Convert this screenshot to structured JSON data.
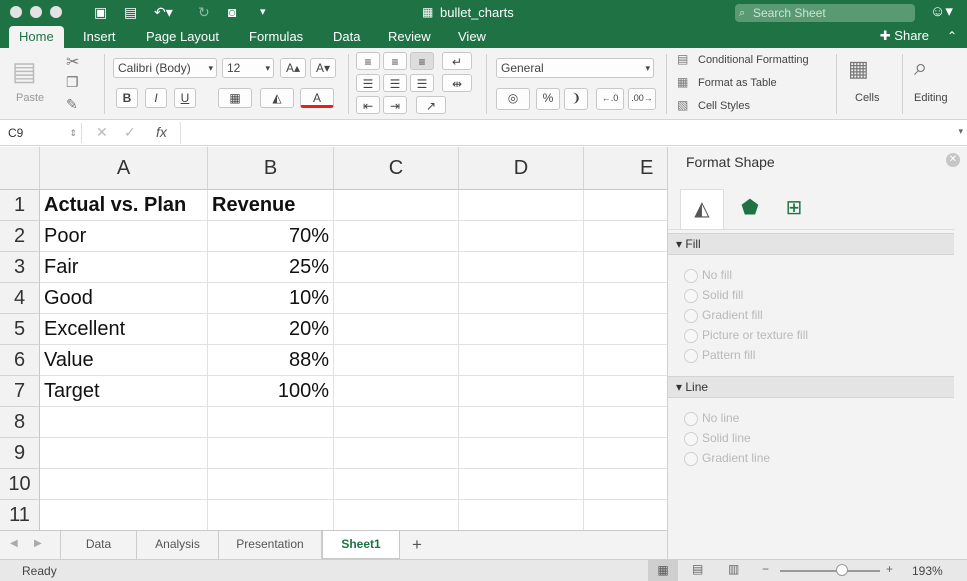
{
  "window": {
    "title": "bullet_charts",
    "search_placeholder": "Search Sheet"
  },
  "ribbon_tabs": [
    "Home",
    "Insert",
    "Page Layout",
    "Formulas",
    "Data",
    "Review",
    "View"
  ],
  "share_label": "Share",
  "ribbon": {
    "paste_label": "Paste",
    "font_name": "Calibri (Body)",
    "font_size": "12",
    "bold": "B",
    "italic": "I",
    "underline": "U",
    "number_format": "General",
    "percent": "%",
    "conditional_formatting": "Conditional Formatting",
    "format_as_table": "Format as Table",
    "cell_styles": "Cell Styles",
    "cells_label": "Cells",
    "editing_label": "Editing"
  },
  "formula_bar": {
    "name_box": "C9",
    "fx": "fx",
    "value": ""
  },
  "grid": {
    "columns": [
      "A",
      "B",
      "C",
      "D",
      "E"
    ],
    "rows": [
      "1",
      "2",
      "3",
      "4",
      "5",
      "6",
      "7",
      "8",
      "9",
      "10",
      "11"
    ],
    "data": [
      [
        "Actual vs. Plan",
        "Revenue"
      ],
      [
        "Poor",
        "70%"
      ],
      [
        "Fair",
        "25%"
      ],
      [
        "Good",
        "10%"
      ],
      [
        "Excellent",
        "20%"
      ],
      [
        "Value",
        "88%"
      ],
      [
        "Target",
        "100%"
      ]
    ]
  },
  "sheet_tabs": [
    "Data",
    "Analysis",
    "Presentation",
    "Sheet1"
  ],
  "active_sheet": "Sheet1",
  "status": {
    "text": "Ready",
    "zoom": "193%"
  },
  "format_pane": {
    "title": "Format Shape",
    "fill_section": "Fill",
    "fill_options": [
      "No fill",
      "Solid fill",
      "Gradient fill",
      "Picture or texture fill",
      "Pattern fill"
    ],
    "line_section": "Line",
    "line_options": [
      "No line",
      "Solid line",
      "Gradient line"
    ]
  },
  "colors": {
    "accent": "#1f7244",
    "ribbon_bg": "#f3f3f3"
  }
}
